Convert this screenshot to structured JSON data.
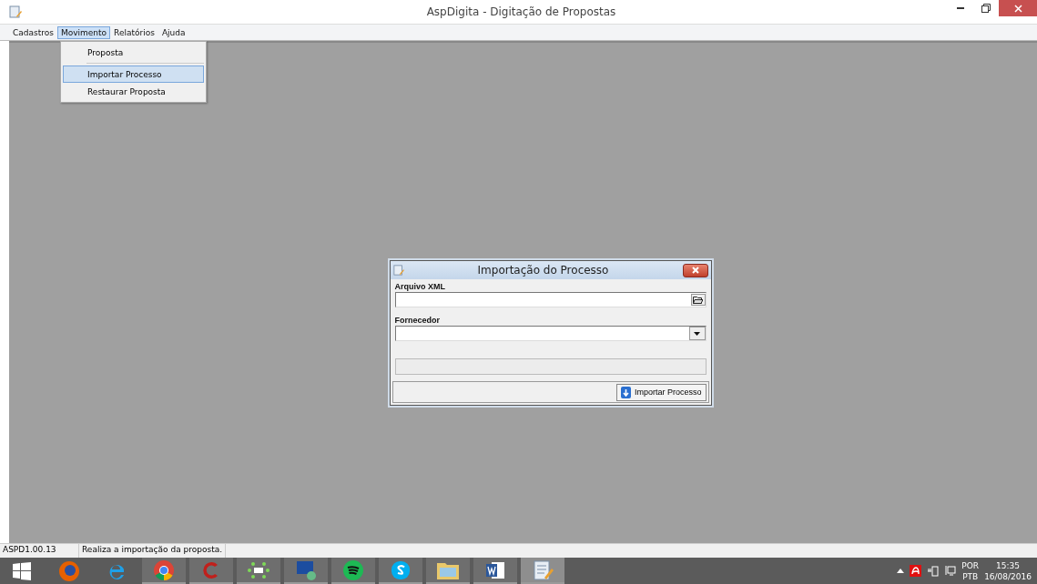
{
  "window": {
    "title": "AspDigita - Digitação de Propostas"
  },
  "menu": [
    {
      "label": "Cadastros",
      "selected": false
    },
    {
      "label": "Movimento",
      "selected": true
    },
    {
      "label": "Relatórios",
      "selected": false
    },
    {
      "label": "Ajuda",
      "selected": false
    }
  ],
  "dropdown": {
    "items": [
      {
        "label": "Proposta",
        "selected": false
      },
      {
        "label": "Importar Processo",
        "selected": true
      },
      {
        "label": "Restaurar Proposta",
        "selected": false
      }
    ]
  },
  "dialog": {
    "title": "Importação do Processo",
    "file_label": "Arquivo XML",
    "supplier_label": "Fornecedor",
    "button": "Importar Processo",
    "progress": {
      "level": 0
    }
  },
  "status_bar": {
    "version": "ASPD1.00.13",
    "message": "Realiza a importação da proposta."
  },
  "taskbar": {
    "apps": [
      {
        "kind": "start",
        "running": false,
        "selected": false
      },
      {
        "kind": "firefox",
        "running": false,
        "selected": false
      },
      {
        "kind": "ie",
        "running": false,
        "selected": false
      },
      {
        "kind": "chrome",
        "running": true,
        "selected": false
      },
      {
        "kind": "c",
        "running": true,
        "selected": false
      },
      {
        "kind": "ib",
        "running": true,
        "selected": false
      },
      {
        "kind": "remote",
        "running": true,
        "selected": false
      },
      {
        "kind": "spotify",
        "running": true,
        "selected": false
      },
      {
        "kind": "skype",
        "running": true,
        "selected": false
      },
      {
        "kind": "folder",
        "running": true,
        "selected": false
      },
      {
        "kind": "word",
        "running": true,
        "selected": false
      },
      {
        "kind": "notepad",
        "running": true,
        "selected": true
      }
    ],
    "lang_top": "POR",
    "lang_bottom": "PTB",
    "time": "15:35",
    "date": "16/08/2016"
  }
}
